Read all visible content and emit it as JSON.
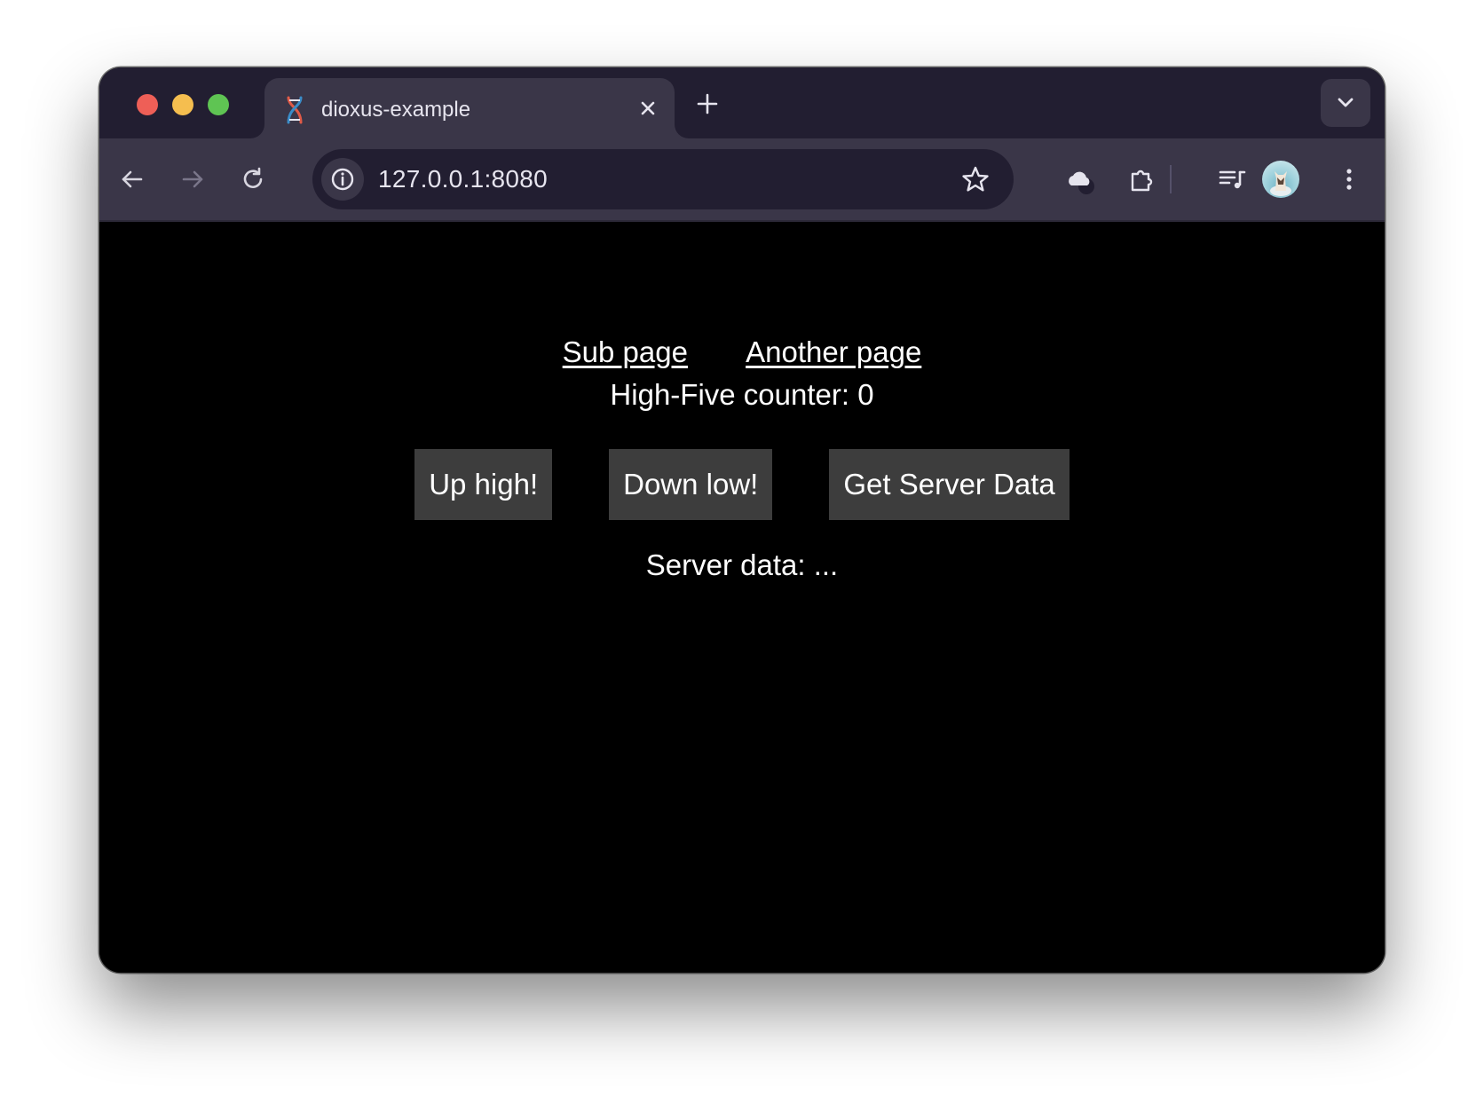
{
  "browser": {
    "tab_title": "dioxus-example",
    "url": "127.0.0.1:8080",
    "icons": {
      "close_tab": "close-icon",
      "new_tab": "plus-icon",
      "tab_search": "chevron-down-icon",
      "back": "arrow-left-icon",
      "forward": "arrow-right-icon",
      "reload": "reload-icon",
      "site_info": "info-icon",
      "bookmark": "star-icon",
      "cloud": "cloud-icon",
      "extensions": "puzzle-icon",
      "media": "media-queue-icon",
      "menu": "kebab-menu-icon"
    }
  },
  "page": {
    "links": {
      "sub_page": "Sub page",
      "another_page": "Another page"
    },
    "counter_text": "High-Five counter: 0",
    "buttons": {
      "up_high": "Up high!",
      "down_low": "Down low!",
      "get_server_data": "Get Server Data"
    },
    "server_data_text": "Server data: ..."
  },
  "colors": {
    "tabstrip_bg": "#221e31",
    "toolbar_bg": "#3a3648",
    "page_bg": "#000000",
    "button_bg": "#3d3d3d",
    "text": "#ffffff"
  }
}
